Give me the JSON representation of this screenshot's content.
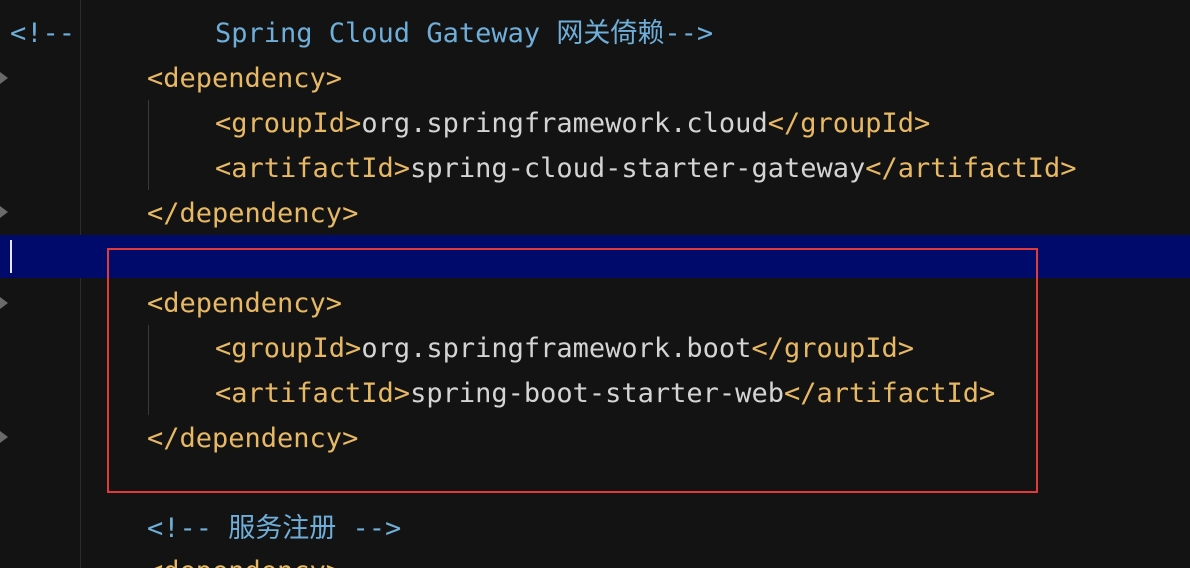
{
  "editor": {
    "lines": {
      "l1": {
        "comment_open": "<!--",
        "comment_text": "Spring Cloud Gateway 网关倚赖-->"
      },
      "l2": {
        "tag": "<dependency>"
      },
      "l3": {
        "open": "<groupId>",
        "value": "org.springframework.cloud",
        "close": "</groupId>"
      },
      "l4": {
        "open": "<artifactId>",
        "value": "spring-cloud-starter-gateway",
        "close": "</artifactId>"
      },
      "l5": {
        "tag": "</dependency>"
      },
      "l7": {
        "tag": "<dependency>"
      },
      "l8": {
        "open": "<groupId>",
        "value": "org.springframework.boot",
        "close": "</groupId>"
      },
      "l9": {
        "open": "<artifactId>",
        "value": "spring-boot-starter-web",
        "close": "</artifactId>"
      },
      "l10": {
        "tag": "</dependency>"
      },
      "l12": {
        "comment": "<!-- 服务注册 -->"
      },
      "l13": {
        "tag": "<dependency>"
      }
    }
  },
  "colors": {
    "background": "#131313",
    "tag": "#e8b964",
    "text": "#d4d4d4",
    "comment": "#6eaed8",
    "current_line": "#000a6b",
    "highlight_border": "#e03a3a"
  }
}
